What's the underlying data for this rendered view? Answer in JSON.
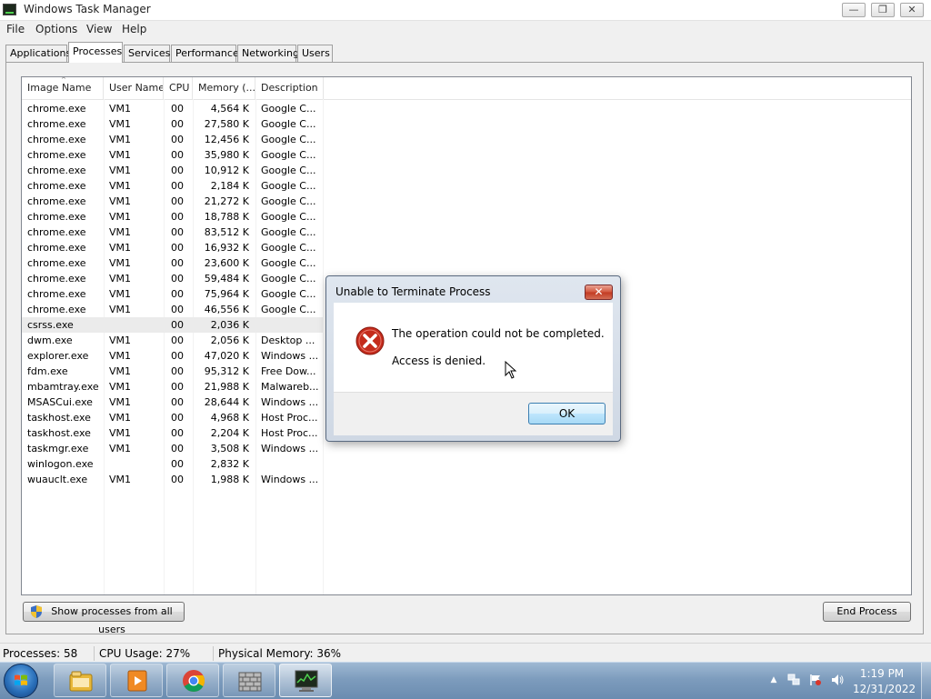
{
  "window": {
    "title": "Windows Task Manager",
    "controls": {
      "minimize": "—",
      "restore": "❐",
      "close": "✕"
    }
  },
  "menu": [
    "File",
    "Options",
    "View",
    "Help"
  ],
  "tabs": [
    {
      "label": "Applications"
    },
    {
      "label": "Processes",
      "active": true
    },
    {
      "label": "Services"
    },
    {
      "label": "Performance"
    },
    {
      "label": "Networking"
    },
    {
      "label": "Users"
    }
  ],
  "process_table": {
    "columns": [
      "Image Name",
      "User Name",
      "CPU",
      "Memory (...",
      "Description"
    ],
    "sort_indicator": "^",
    "rows": [
      {
        "name": "chrome.exe",
        "user": "VM1",
        "cpu": "00",
        "memory": "4,564 K",
        "desc": "Google C..."
      },
      {
        "name": "chrome.exe",
        "user": "VM1",
        "cpu": "00",
        "memory": "27,580 K",
        "desc": "Google C..."
      },
      {
        "name": "chrome.exe",
        "user": "VM1",
        "cpu": "00",
        "memory": "12,456 K",
        "desc": "Google C..."
      },
      {
        "name": "chrome.exe",
        "user": "VM1",
        "cpu": "00",
        "memory": "35,980 K",
        "desc": "Google C..."
      },
      {
        "name": "chrome.exe",
        "user": "VM1",
        "cpu": "00",
        "memory": "10,912 K",
        "desc": "Google C..."
      },
      {
        "name": "chrome.exe",
        "user": "VM1",
        "cpu": "00",
        "memory": "2,184 K",
        "desc": "Google C..."
      },
      {
        "name": "chrome.exe",
        "user": "VM1",
        "cpu": "00",
        "memory": "21,272 K",
        "desc": "Google C..."
      },
      {
        "name": "chrome.exe",
        "user": "VM1",
        "cpu": "00",
        "memory": "18,788 K",
        "desc": "Google C..."
      },
      {
        "name": "chrome.exe",
        "user": "VM1",
        "cpu": "00",
        "memory": "83,512 K",
        "desc": "Google C..."
      },
      {
        "name": "chrome.exe",
        "user": "VM1",
        "cpu": "00",
        "memory": "16,932 K",
        "desc": "Google C..."
      },
      {
        "name": "chrome.exe",
        "user": "VM1",
        "cpu": "00",
        "memory": "23,600 K",
        "desc": "Google C..."
      },
      {
        "name": "chrome.exe",
        "user": "VM1",
        "cpu": "00",
        "memory": "59,484 K",
        "desc": "Google C..."
      },
      {
        "name": "chrome.exe",
        "user": "VM1",
        "cpu": "00",
        "memory": "75,964 K",
        "desc": "Google C..."
      },
      {
        "name": "chrome.exe",
        "user": "VM1",
        "cpu": "00",
        "memory": "46,556 K",
        "desc": "Google C..."
      },
      {
        "name": "csrss.exe",
        "user": "",
        "cpu": "00",
        "memory": "2,036 K",
        "desc": "",
        "selected": true
      },
      {
        "name": "dwm.exe",
        "user": "VM1",
        "cpu": "00",
        "memory": "2,056 K",
        "desc": "Desktop ..."
      },
      {
        "name": "explorer.exe",
        "user": "VM1",
        "cpu": "00",
        "memory": "47,020 K",
        "desc": "Windows ..."
      },
      {
        "name": "fdm.exe",
        "user": "VM1",
        "cpu": "00",
        "memory": "95,312 K",
        "desc": "Free Dow..."
      },
      {
        "name": "mbamtray.exe",
        "user": "VM1",
        "cpu": "00",
        "memory": "21,988 K",
        "desc": "Malwareb..."
      },
      {
        "name": "MSASCui.exe",
        "user": "VM1",
        "cpu": "00",
        "memory": "28,644 K",
        "desc": "Windows ..."
      },
      {
        "name": "taskhost.exe",
        "user": "VM1",
        "cpu": "00",
        "memory": "4,968 K",
        "desc": "Host Proc..."
      },
      {
        "name": "taskhost.exe",
        "user": "VM1",
        "cpu": "00",
        "memory": "2,204 K",
        "desc": "Host Proc..."
      },
      {
        "name": "taskmgr.exe",
        "user": "VM1",
        "cpu": "00",
        "memory": "3,508 K",
        "desc": "Windows ..."
      },
      {
        "name": "winlogon.exe",
        "user": "",
        "cpu": "00",
        "memory": "2,832 K",
        "desc": ""
      },
      {
        "name": "wuauclt.exe",
        "user": "VM1",
        "cpu": "00",
        "memory": "1,988 K",
        "desc": "Windows ..."
      }
    ]
  },
  "buttons": {
    "show_all": "Show processes from all users",
    "end_process": "End Process"
  },
  "status": {
    "processes": "Processes: 58",
    "cpu": "CPU Usage: 27%",
    "memory": "Physical Memory: 36%"
  },
  "dialog": {
    "title": "Unable to Terminate Process",
    "close": "✕",
    "message": "The operation could not be completed.",
    "detail": "Access is denied.",
    "ok": "OK",
    "icon": "error-icon"
  },
  "taskbar": {
    "pinned": [
      "explorer-icon",
      "media-player-icon",
      "chrome-icon",
      "firewall-icon",
      "task-manager-icon"
    ],
    "tray": [
      "show-hidden-icons",
      "network-icon",
      "action-center-icon",
      "volume-icon"
    ],
    "clock": {
      "time": "1:19 PM",
      "date": "12/31/2022"
    }
  },
  "colors": {
    "error_red": "#c42b1c",
    "selection": "#ebebeb",
    "taskbar": "#7d9cbd"
  }
}
